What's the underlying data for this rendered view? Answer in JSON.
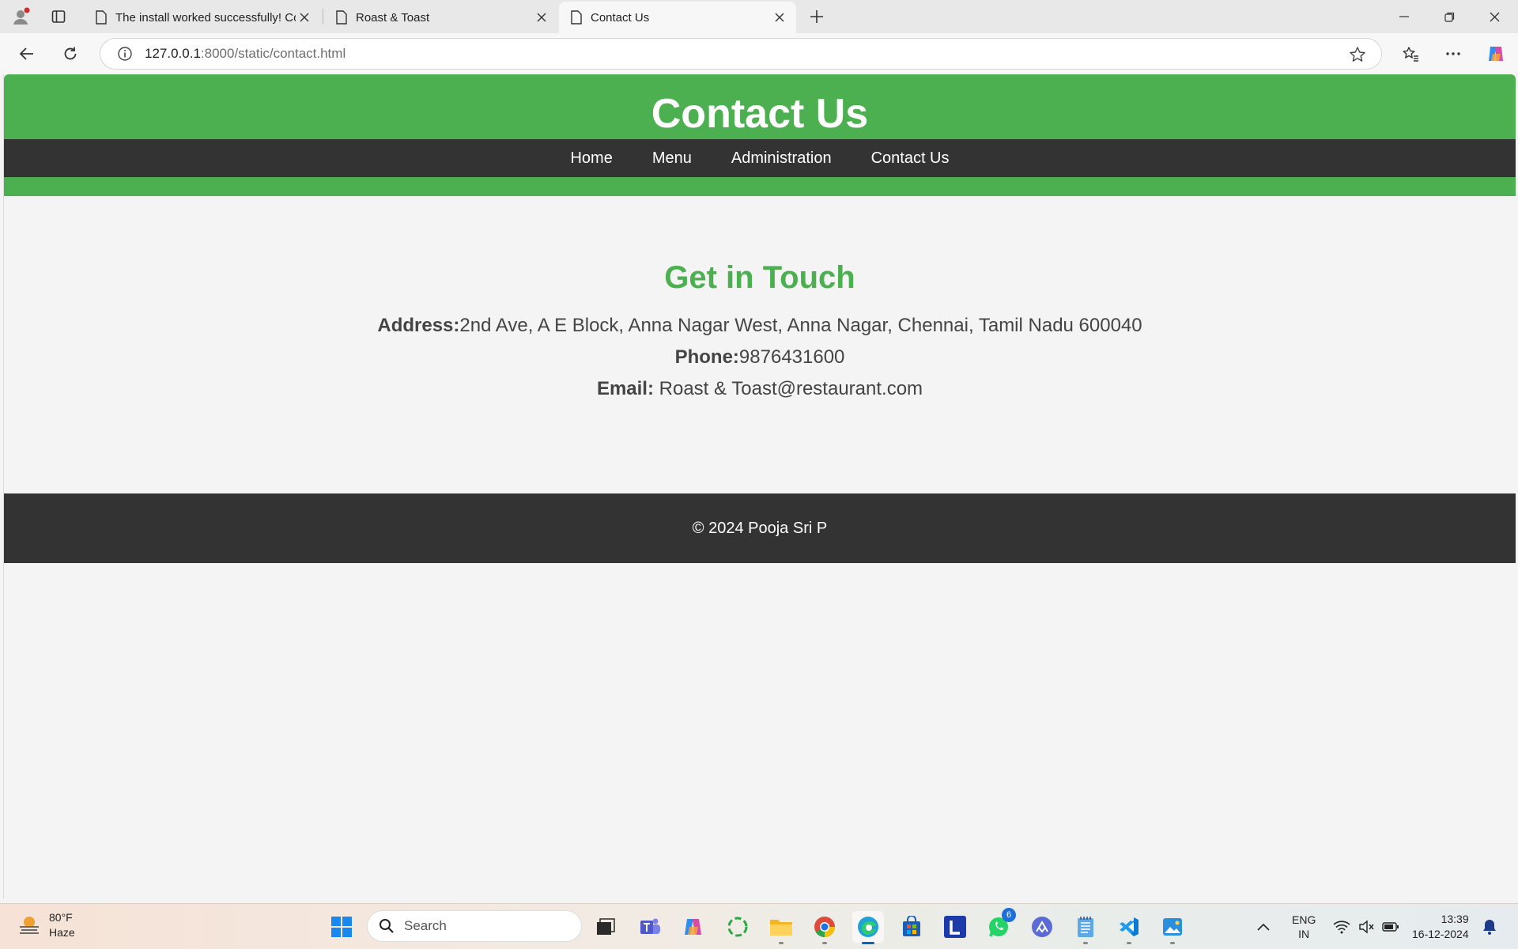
{
  "browser": {
    "tabs": [
      {
        "title": "The install worked successfully! Co"
      },
      {
        "title": "Roast & Toast"
      },
      {
        "title": "Contact Us"
      }
    ],
    "url_host": "127.0.0.1",
    "url_path": ":8000/static/contact.html"
  },
  "site": {
    "header_title": "Contact Us",
    "nav": [
      "Home",
      "Menu",
      "Administration",
      "Contact Us"
    ],
    "contact": {
      "heading": "Get in Touch",
      "address_label": "Address:",
      "address_value": "2nd Ave, A E Block, Anna Nagar West, Anna Nagar, Chennai, Tamil Nadu 600040",
      "phone_label": "Phone:",
      "phone_value": "9876431600",
      "email_label": "Email:",
      "email_value": " Roast & Toast@restaurant.com"
    },
    "footer": "© 2024 Pooja Sri P",
    "colors": {
      "brand_green": "#4caf50",
      "nav_dark": "#333333"
    }
  },
  "taskbar": {
    "weather_temp": "80°F",
    "weather_desc": "Haze",
    "search_placeholder": "Search",
    "whatsapp_badge": "6",
    "lang_top": "ENG",
    "lang_bottom": "IN",
    "time": "13:39",
    "date": "16-12-2024"
  }
}
